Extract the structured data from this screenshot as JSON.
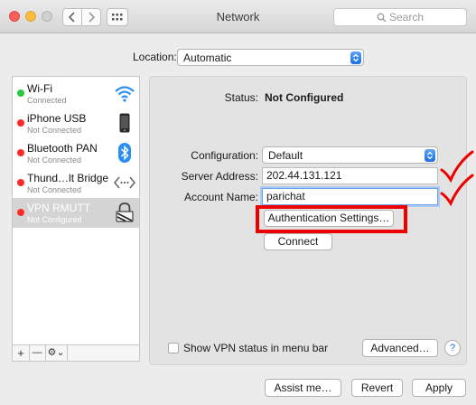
{
  "window": {
    "title": "Network"
  },
  "search": {
    "placeholder": "Search"
  },
  "location": {
    "label": "Location:",
    "value": "Automatic"
  },
  "sidebar": {
    "items": [
      {
        "name": "Wi-Fi",
        "status": "Connected",
        "dot_color": "#29c840",
        "icon": "wifi-icon"
      },
      {
        "name": "iPhone USB",
        "status": "Not Connected",
        "dot_color": "#ff2a2a",
        "icon": "iphone-icon"
      },
      {
        "name": "Bluetooth PAN",
        "status": "Not Connected",
        "dot_color": "#ff2a2a",
        "icon": "bluetooth-icon"
      },
      {
        "name": "Thund…lt Bridge",
        "status": "Not Connected",
        "dot_color": "#ff2a2a",
        "icon": "thunderbolt-bridge-icon"
      },
      {
        "name": "VPN RMUTT",
        "status": "Not Configured",
        "dot_color": "#ff2a2a",
        "icon": "vpn-lock-icon",
        "selected": true
      }
    ],
    "add_label": "+",
    "remove_label": "—",
    "gear_label": "⚙⌄"
  },
  "detail": {
    "status_label": "Status:",
    "status_value": "Not Configured",
    "configuration_label": "Configuration:",
    "configuration_value": "Default",
    "server_label": "Server Address:",
    "server_value": "202.44.131.121",
    "account_label": "Account Name:",
    "account_value": "parichat",
    "auth_button": "Authentication Settings…",
    "connect_button": "Connect"
  },
  "footer": {
    "show_vpn_label": "Show VPN status in menu bar",
    "advanced_button": "Advanced…",
    "help_label": "?",
    "assist_button": "Assist me…",
    "revert_button": "Revert",
    "apply_button": "Apply"
  },
  "colors": {
    "accent": "#1e6fe0",
    "annotation_red": "#ee0000",
    "selected_row": "#d4d4d4"
  }
}
